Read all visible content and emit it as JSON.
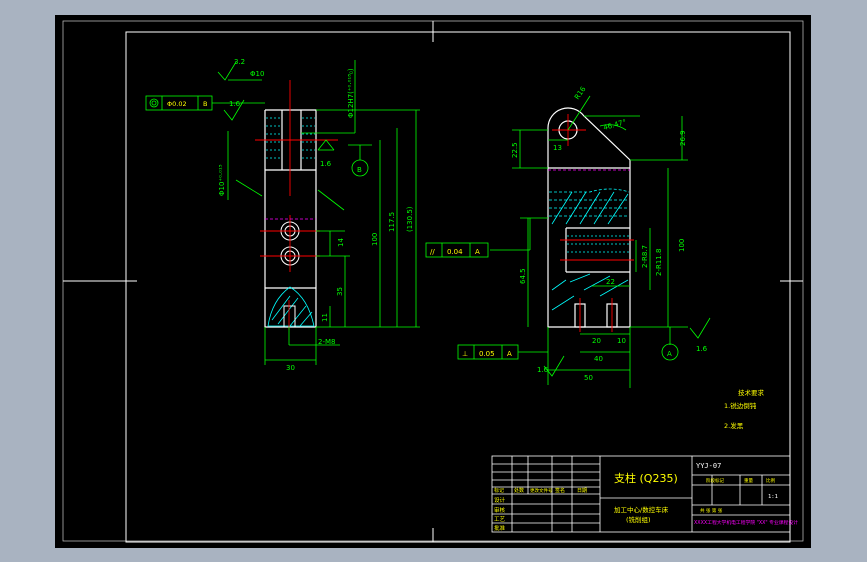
{
  "drawing": {
    "part_title": "支柱 (Q235)",
    "drawing_code": "YYJ-07",
    "subtitle_line1": "加工中心/数控车床",
    "subtitle_line2": "(铣削组)",
    "tech_req_title": "技术要求",
    "tech_req_1": "1.锐边倒钝",
    "tech_req_2": "2.发黑",
    "school_line": "XXXX工程大学机电工程学院 \"XX\" 专业课程设计"
  },
  "dimensions_left": {
    "roughness_top": "3.2",
    "roughness_side": "1.6",
    "roughness_right": "1.6",
    "bore_fit": "Φ12H7(⁺⁰·⁰¹⁸₀)",
    "bore_label": "Φ10",
    "side_bore": "Φ10⁺⁰·⁰¹⁵",
    "dim_30": "30",
    "dim_m8": "2-M8",
    "dim_11": "11",
    "dim_35": "35",
    "dim_14": "14",
    "dim_100": "100",
    "dim_117_5": "117.5",
    "dim_130_5": "(130.5)",
    "datum_b": "B",
    "tol_frame": "◎ Φ0.02 B"
  },
  "dimensions_right": {
    "radius": "R16",
    "angle": "46.47°",
    "dim_22_5": "22.5",
    "dim_13": "13",
    "dim_26_9": "26.9",
    "dim_100": "100",
    "dim_64_5": "64.5",
    "dim_r87": "2-R8.7",
    "dim_r118": "2-R11.8",
    "dim_22": "22",
    "dim_20": "20",
    "dim_10": "10",
    "dim_40": "40",
    "dim_50": "50",
    "roughness_1": "1.6",
    "roughness_2": "1.6",
    "parallel_frame": "// 0.04 A",
    "perp_frame": "⊥ 0.05 A",
    "datum_a": "A"
  },
  "title_block": {
    "row_labels": [
      "设计",
      "审核",
      "工艺",
      "批准"
    ],
    "header_cells": [
      "标记",
      "处数",
      "更改文件号",
      "签名",
      "日期"
    ],
    "right_header": [
      "阶段标记",
      "重量",
      "比例"
    ],
    "scale": "1:1",
    "sheet": "共  张   第  张"
  },
  "colors": {
    "background": "#000000",
    "frame": "#ffffff",
    "dimension": "#00ff00",
    "center": "#ff0000",
    "hatch": "#00ffff",
    "hidden": "#ff00ff",
    "text": "#ffff00"
  }
}
